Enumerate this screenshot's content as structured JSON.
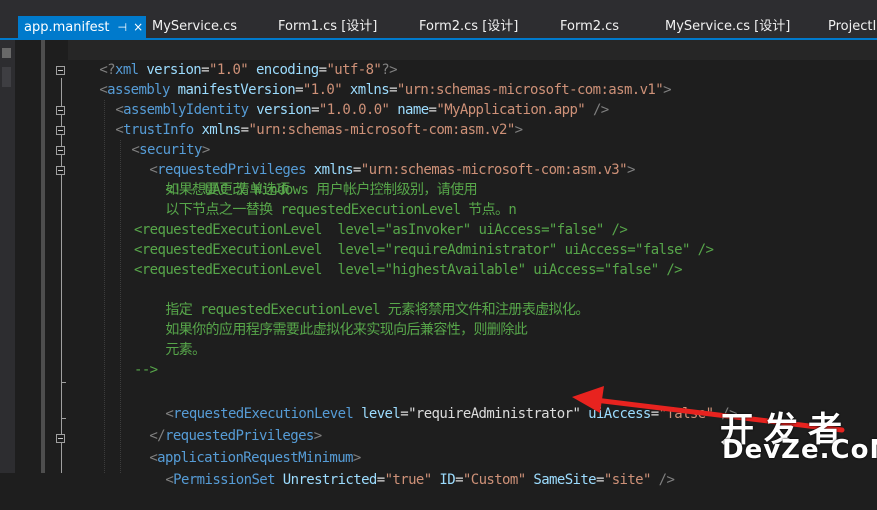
{
  "tabs": [
    {
      "label": "app.manifest",
      "pin": "⊣",
      "close": "×",
      "active": true
    },
    {
      "label": "MyService.cs"
    },
    {
      "label": "Form1.cs [设计]"
    },
    {
      "label": "Form2.cs [设计]"
    },
    {
      "label": "Form2.cs"
    },
    {
      "label": "MyService.cs [设计]"
    },
    {
      "label": "ProjectIn"
    }
  ],
  "code": {
    "l1": {
      "p1": "<?",
      "tag": "xml",
      "a1": " version",
      "eq1": "=",
      "v1": "\"1.0\"",
      "a2": " encoding",
      "eq2": "=",
      "v2": "\"utf-8\"",
      "p2": "?>"
    },
    "l2": {
      "p1": "<",
      "tag": "assembly",
      "a1": " manifestVersion",
      "eq1": "=",
      "v1": "\"1.0\"",
      "a2": " xmlns",
      "eq2": "=",
      "v2": "\"urn:schemas-microsoft-com:asm.v1\"",
      "p2": ">"
    },
    "l3": {
      "p1": "<",
      "tag": "assemblyIdentity",
      "a1": " version",
      "eq1": "=",
      "v1": "\"1.0.0.0\"",
      "a2": " name",
      "eq2": "=",
      "v2": "\"MyApplication.app\"",
      "p2": " />"
    },
    "l4": {
      "p1": "<",
      "tag": "trustInfo",
      "a1": " xmlns",
      "eq1": "=",
      "v1": "\"urn:schemas-microsoft-com:asm.v2\"",
      "p2": ">"
    },
    "l5": {
      "p1": "<",
      "tag": "security",
      "p2": ">"
    },
    "l6": {
      "p1": "<",
      "tag": "requestedPrivileges",
      "a1": " xmlns",
      "eq1": "=",
      "v1": "\"urn:schemas-microsoft-com:asm.v3\"",
      "p2": ">"
    },
    "l7": {
      "p1": "<!--",
      "text": " UAC 清单选项"
    },
    "l8": {
      "text": "    如果想要更改 Windows 用户帐户控制级别，请使用"
    },
    "l9": {
      "text": "    以下节点之一替换 requestedExecutionLevel 节点。n"
    },
    "l10": {
      "text": "<requestedExecutionLevel  level=\"asInvoker\" uiAccess=\"false\" />"
    },
    "l11": {
      "text": "<requestedExecutionLevel  level=\"requireAdministrator\" uiAccess=\"false\" />"
    },
    "l12": {
      "text": "<requestedExecutionLevel  level=\"highestAvailable\" uiAccess=\"false\" />"
    },
    "l14": {
      "text": "    指定 requestedExecutionLevel 元素将禁用文件和注册表虚拟化。"
    },
    "l15": {
      "text": "    如果你的应用程序需要此虚拟化来实现向后兼容性，则删除此"
    },
    "l16": {
      "text": "    元素。"
    },
    "l17": {
      "text": "-->"
    },
    "l18": {
      "p1": "<",
      "tag": "requestedExecutionLevel",
      "a1": " level",
      "eq1": "=",
      "v1": "\"requireAdministrator\"",
      "a2": " uiAccess",
      "eq2": "=",
      "v2": "\"false\"",
      "p2": " />"
    },
    "l19": {
      "p1": "</",
      "tag": "requestedPrivileges",
      "p2": ">"
    },
    "l20": {
      "p1": "<",
      "tag": "applicationRequestMinimum",
      "p2": ">"
    },
    "l21": {
      "p1": "<",
      "tag": "PermissionSet",
      "a1": " Unrestricted",
      "eq1": "=",
      "v1": "\"true\"",
      "a2": " ID",
      "eq2": "=",
      "v2": "\"Custom\"",
      "a3": " SameSite",
      "eq3": "=",
      "v3": "\"site\"",
      "p2": " />"
    }
  },
  "watermark": {
    "line1": "开发者",
    "line2": "DevZe.CoM"
  },
  "colors": {
    "accent": "#007acc",
    "arrow": "#e8231f",
    "tag": "#569cd6",
    "attr": "#9cdcfe",
    "value": "#ce9178",
    "comment": "#57a64a"
  }
}
